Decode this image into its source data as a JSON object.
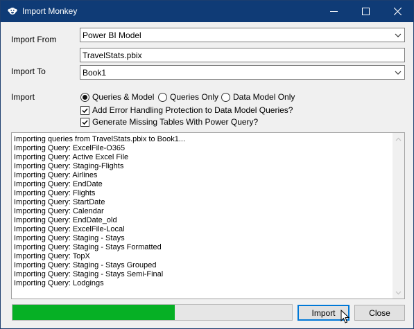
{
  "window": {
    "title": "Import Monkey",
    "icon": "monkey-icon"
  },
  "form": {
    "import_from_label": "Import From",
    "import_from_value": "Power BI Model",
    "file_value": "TravelStats.pbix",
    "import_to_label": "Import To",
    "import_to_value": "Book1",
    "import_label": "Import"
  },
  "options": {
    "radios": [
      {
        "label": "Queries & Model",
        "checked": true
      },
      {
        "label": "Queries Only",
        "checked": false
      },
      {
        "label": "Data Model Only",
        "checked": false
      }
    ],
    "checkboxes": [
      {
        "label": "Add Error Handling Protection to Data Model Queries?",
        "checked": true
      },
      {
        "label": "Generate Missing Tables With Power Query?",
        "checked": true
      }
    ]
  },
  "log": {
    "lines": [
      "Importing queries from TravelStats.pbix to Book1...",
      "Importing Query: ExcelFile-O365",
      "Importing Query: Active Excel File",
      "Importing Query: Staging-Flights",
      "Importing Query: Airlines",
      "Importing Query: EndDate",
      "Importing Query: Flights",
      "Importing Query: StartDate",
      "Importing Query: Calendar",
      "Importing Query: EndDate_old",
      "Importing Query: ExcelFile-Local",
      "Importing Query: Staging - Stays",
      "Importing Query: Staging - Stays Formatted",
      "Importing Query: TopX",
      "Importing Query: Staging - Stays Grouped",
      "Importing Query: Staging - Stays Semi-Final",
      "Importing Query: Lodgings"
    ]
  },
  "progress": {
    "fraction": 0.58,
    "color": "#06b025"
  },
  "buttons": {
    "import": "Import",
    "close": "Close"
  },
  "colors": {
    "titlebar": "#0f3b76",
    "default_button_border": "#0078d7"
  }
}
